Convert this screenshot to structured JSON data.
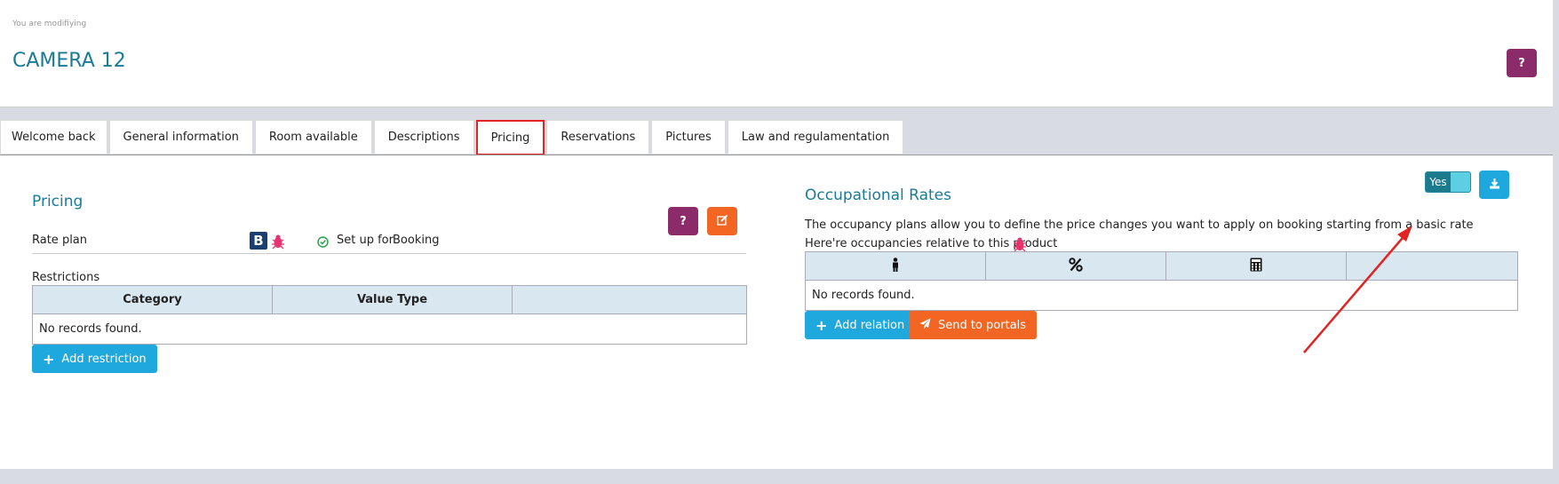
{
  "header": {
    "modifying_label": "You are modifiying",
    "title": "CAMERA 12",
    "help_label": "?"
  },
  "tabs": [
    {
      "label": "Welcome back"
    },
    {
      "label": "General information"
    },
    {
      "label": "Room available"
    },
    {
      "label": "Descriptions"
    },
    {
      "label": "Pricing",
      "active": true
    },
    {
      "label": "Reservations"
    },
    {
      "label": "Pictures"
    },
    {
      "label": "Law and regulamentation"
    }
  ],
  "pricing": {
    "title": "Pricing",
    "rate_plan_label": "Rate plan",
    "booking_logo_letter": "B",
    "setup_prefix": "Set up for",
    "setup_target": "Booking",
    "help_label": "?",
    "restrictions_label": "Restrictions",
    "restrictions_table": {
      "headers": [
        "Category",
        "Value Type",
        ""
      ],
      "empty_text": "No records found."
    },
    "add_restriction_label": "Add restriction"
  },
  "occupational": {
    "title": "Occupational Rates",
    "toggle_label": "Yes",
    "description": "The occupancy plans allow you to define the price changes you want to apply on booking starting from a basic rate",
    "occupancies_label": "Here're occupancies relative to this product",
    "table": {
      "header_icons": [
        "person-icon",
        "percent-icon",
        "calculator-icon",
        ""
      ],
      "empty_text": "No records found."
    },
    "add_relation_label": "Add relation",
    "send_to_portals_label": "Send to portals"
  },
  "colors": {
    "accent": "#1b7a96",
    "purple": "#8b2b69",
    "orange": "#f26522",
    "blue": "#1ea8dd",
    "annotation": "#e02424"
  }
}
